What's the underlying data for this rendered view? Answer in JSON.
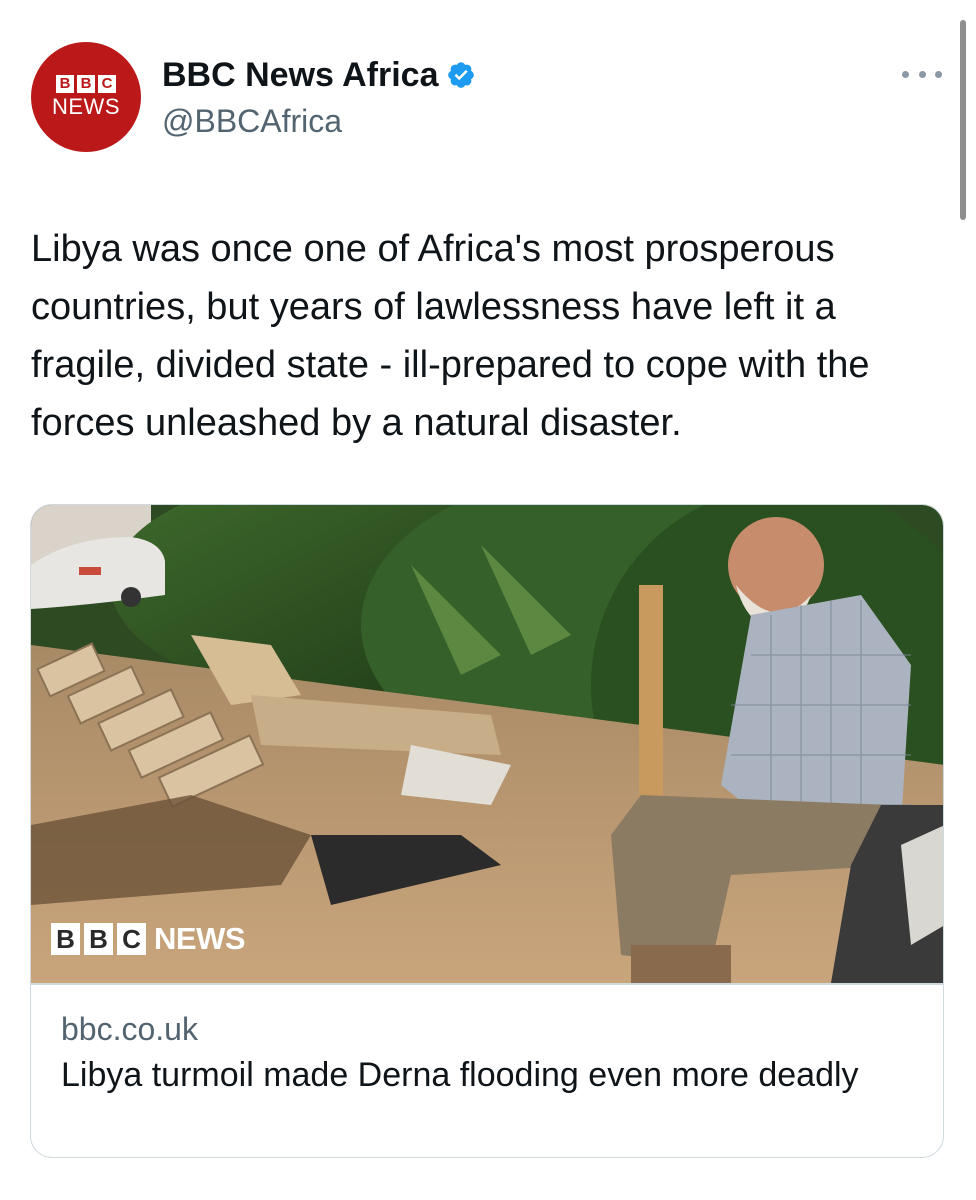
{
  "author": {
    "display_name": "BBC News Africa",
    "handle": "@BBCAfrica",
    "avatar": {
      "blocks": [
        "B",
        "B",
        "C"
      ],
      "word": "NEWS",
      "color": "#bb1919"
    },
    "verified_icon": "verified-badge-icon",
    "verified_color": "#1d9bf0"
  },
  "menu_icon": "more-options-icon",
  "tweet": {
    "text": "Libya was once one of Africa's most prosperous countries, but years of lawlessness have left it a fragile, divided state - ill-prepared to cope with the forces unleashed by a natural disaster."
  },
  "link_card": {
    "image_watermark": {
      "blocks": [
        "B",
        "B",
        "C"
      ],
      "word": "NEWS"
    },
    "domain": "bbc.co.uk",
    "title": "Libya turmoil made Derna flooding even more deadly"
  }
}
